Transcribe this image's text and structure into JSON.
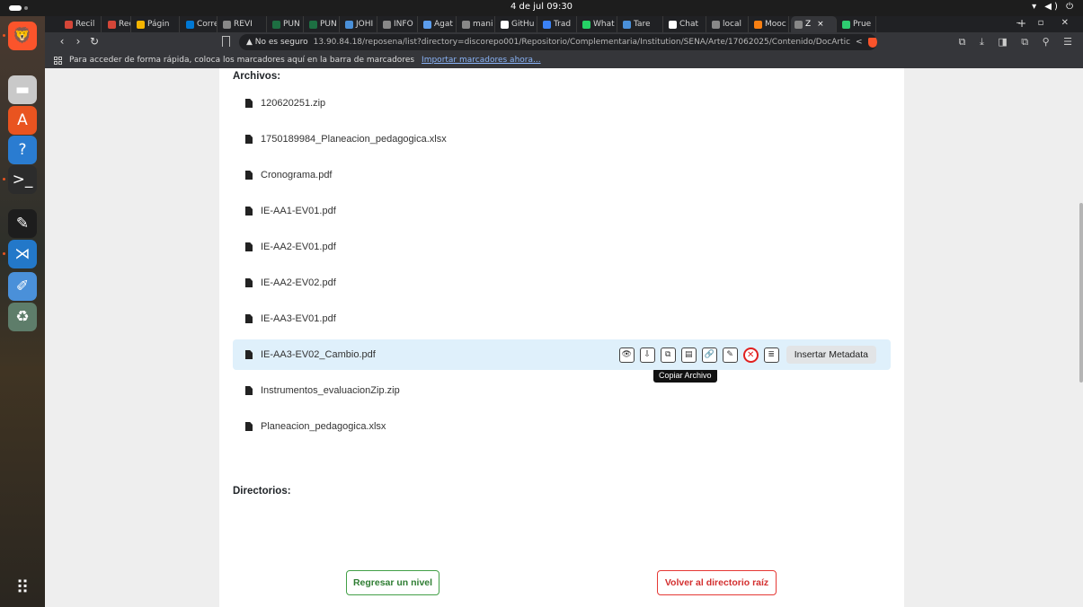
{
  "system": {
    "clock": "4 de jul 09:30",
    "tray": "▾ ◀) ⏻"
  },
  "dock": {
    "items": [
      {
        "name": "brave-browser",
        "color": "#fb542b",
        "glyph": "🦁"
      },
      {
        "name": "files",
        "color": "#c9c9c9",
        "glyph": "▬"
      },
      {
        "name": "app-center",
        "color": "#e95420",
        "glyph": "A"
      },
      {
        "name": "help",
        "color": "#2a7cd1",
        "glyph": "?"
      },
      {
        "name": "terminal",
        "color": "#2c2c2c",
        "glyph": ">_"
      },
      {
        "name": "inkscape",
        "color": "#1d1d1d",
        "glyph": "✎"
      },
      {
        "name": "vscode",
        "color": "#2378c9",
        "glyph": "⋊"
      },
      {
        "name": "text-editor",
        "color": "#4a90d9",
        "glyph": "✐"
      },
      {
        "name": "trash",
        "color": "#5e7d6a",
        "glyph": "♻"
      }
    ],
    "bottom_glyph": "⠿"
  },
  "browser": {
    "tabs": [
      {
        "label": "Recil",
        "color": "#d44638"
      },
      {
        "label": "Recil",
        "color": "#d44638"
      },
      {
        "label": "Págin",
        "color": "#f4b400"
      },
      {
        "label": "Corre",
        "color": "#0078d4"
      },
      {
        "label": "REVI",
        "color": "#888888"
      },
      {
        "label": "PUN",
        "color": "#1d6f42"
      },
      {
        "label": "PUN",
        "color": "#1d6f42"
      },
      {
        "label": "JOHI",
        "color": "#4a90d9"
      },
      {
        "label": "INFO",
        "color": "#888888"
      },
      {
        "label": "Agat",
        "color": "#5c9ded"
      },
      {
        "label": "mani",
        "color": "#888888"
      },
      {
        "label": "GitHu",
        "color": "#ffffff"
      },
      {
        "label": "Trad",
        "color": "#3b82f6"
      },
      {
        "label": "What",
        "color": "#25d366"
      },
      {
        "label": "Tare",
        "color": "#4a90d9"
      },
      {
        "label": "Chat",
        "color": "#ffffff"
      },
      {
        "label": "local",
        "color": "#888888"
      },
      {
        "label": "Mooc",
        "color": "#f98012"
      },
      {
        "label": "Z",
        "color": "#888888",
        "active": true
      },
      {
        "label": "Prue",
        "color": "#2ecc71"
      }
    ],
    "new_tab": "+",
    "window_controls": "– ▫ ✕",
    "nav": {
      "back": "‹",
      "forward": "›",
      "reload": "↻"
    },
    "security_label": "▲ No es seguro",
    "url": "13.90.84.18/reposena/list?directory=discorepo001/Repositorio/Complementaria/Institution/SENA/Arte/17062025/Contenido/DocArtic",
    "toolbar_right": "⧉ ⤓ ◨ ⧉ ⚲ ☰",
    "bookmarks_message": "Para acceder de forma rápida, coloca los marcadores aquí en la barra de marcadores",
    "bookmarks_link": "Importar marcadores ahora..."
  },
  "page": {
    "files_title": "Archivos:",
    "files": [
      "120620251.zip",
      "1750189984_Planeacion_pedagogica.xlsx",
      "Cronograma.pdf",
      "IE-AA1-EV01.pdf",
      "IE-AA2-EV01.pdf",
      "IE-AA2-EV02.pdf",
      "IE-AA3-EV01.pdf",
      "IE-AA3-EV02_Cambio.pdf",
      "Instrumentos_evaluacionZip.zip",
      "Planeacion_pedagogica.xlsx"
    ],
    "highlighted_index": 7,
    "actions": [
      {
        "name": "view-icon",
        "glyph": "👁"
      },
      {
        "name": "download-icon",
        "glyph": "⇩"
      },
      {
        "name": "copy-file-icon",
        "glyph": "⧉"
      },
      {
        "name": "clipboard-icon",
        "glyph": "▤"
      },
      {
        "name": "link-icon",
        "glyph": "🔗"
      },
      {
        "name": "edit-icon",
        "glyph": "✎"
      },
      {
        "name": "delete-icon",
        "glyph": "✕"
      },
      {
        "name": "metadata-icon",
        "glyph": "≣"
      }
    ],
    "insert_metadata_label": "Insertar Metadata",
    "tooltip": "Copiar Archivo",
    "dirs_title": "Directorios:",
    "back_level_label": "Regresar un nivel",
    "root_label": "Volver al directorio raíz"
  }
}
